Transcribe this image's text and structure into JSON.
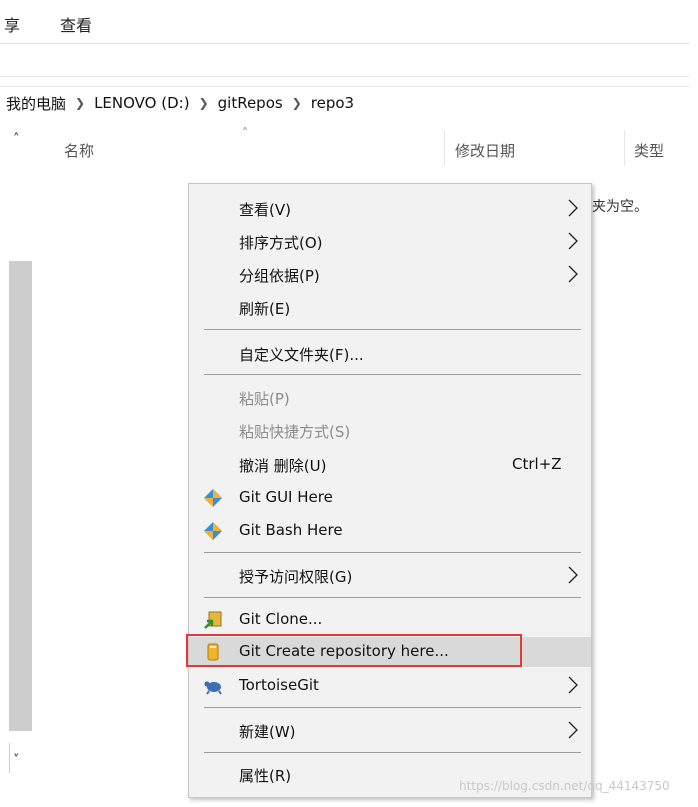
{
  "ribbon": {
    "share_tab": "享",
    "view_tab": "查看"
  },
  "breadcrumb": [
    "我的电脑",
    "LENOVO (D:)",
    "gitRepos",
    "repo3"
  ],
  "columns": {
    "name": "名称",
    "date": "修改日期",
    "type": "类型"
  },
  "empty_message": "夹为空。",
  "context_menu": {
    "view": "查看(V)",
    "sort": "排序方式(O)",
    "group": "分组依据(P)",
    "refresh": "刷新(E)",
    "customize": "自定义文件夹(F)...",
    "paste": "粘贴(P)",
    "paste_shortcut": "粘贴快捷方式(S)",
    "undo_delete": "撤消 删除(U)",
    "undo_shortcut": "Ctrl+Z",
    "git_gui": "Git GUI Here",
    "git_bash": "Git Bash Here",
    "grant_access": "授予访问权限(G)",
    "git_clone": "Git Clone...",
    "git_create_repo": "Git Create repository here...",
    "tortoisegit": "TortoiseGit",
    "new": "新建(W)",
    "properties": "属性(R)"
  },
  "watermark": "https://blog.csdn.net/qq_44143750",
  "colors": {
    "highlight_border": "#e03a3a",
    "menu_bg": "#f2f2f2",
    "hover_bg": "#d9d9d9"
  }
}
